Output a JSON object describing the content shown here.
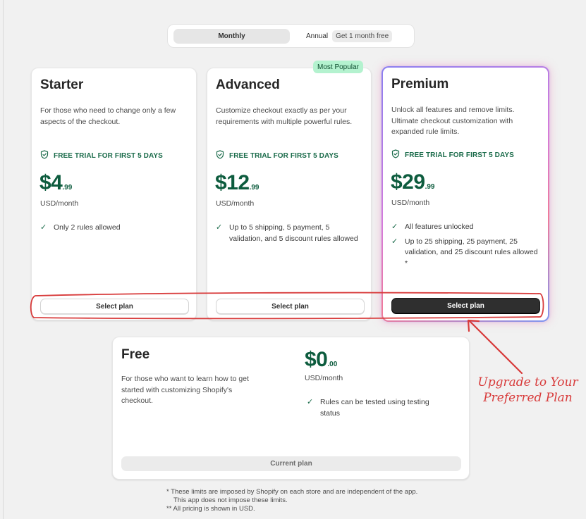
{
  "billing_toggle": {
    "monthly_label": "Monthly",
    "annual_label": "Annual",
    "annual_badge": "Get 1 month free",
    "selected": "Monthly"
  },
  "badge": {
    "most_popular": "Most Popular"
  },
  "plans": [
    {
      "name": "Starter",
      "description": "For those who need to change only a few aspects of the checkout.",
      "trial": "FREE TRIAL FOR FIRST 5 DAYS",
      "price_whole": "$4",
      "price_cents": ".99",
      "unit": "USD/month",
      "features": [
        "Only 2 rules allowed"
      ],
      "button": "Select plan"
    },
    {
      "name": "Advanced",
      "description": "Customize checkout exactly as per your requirements with multiple powerful rules.",
      "trial": "FREE TRIAL FOR FIRST 5 DAYS",
      "price_whole": "$12",
      "price_cents": ".99",
      "unit": "USD/month",
      "features": [
        "Up to 5 shipping, 5 payment, 5 validation, and 5 discount rules allowed"
      ],
      "button": "Select plan"
    },
    {
      "name": "Premium",
      "description": "Unlock all features and remove limits. Ultimate checkout customization with expanded rule limits.",
      "trial": "FREE TRIAL FOR FIRST 5 DAYS",
      "price_whole": "$29",
      "price_cents": ".99",
      "unit": "USD/month",
      "features": [
        "All features unlocked",
        "Up to 25 shipping, 25 payment, 25 validation, and 25 discount rules allowed *"
      ],
      "button": "Select plan"
    }
  ],
  "free_plan": {
    "name": "Free",
    "description": "For those who want to learn how to get started with customizing Shopify's checkout.",
    "price_whole": "$0",
    "price_cents": ".00",
    "unit": "USD/month",
    "features": [
      "Rules can be tested using testing status"
    ],
    "button": "Current plan"
  },
  "footnotes": {
    "line1": "* These limits are imposed by Shopify on each store and are independent of the app.",
    "line2": "This app does not impose these limits.",
    "line3": "** All pricing is shown in USD."
  },
  "annotation": {
    "line1": "Upgrade to Your",
    "line2": "Preferred Plan",
    "color": "#d83b3b"
  },
  "colors": {
    "price_green": "#0d5c3e",
    "badge_green": "#b4f2cf",
    "premium_button": "#2f2f2f"
  },
  "icons": {
    "trial": "shield-check-icon",
    "feature": "check-icon"
  }
}
